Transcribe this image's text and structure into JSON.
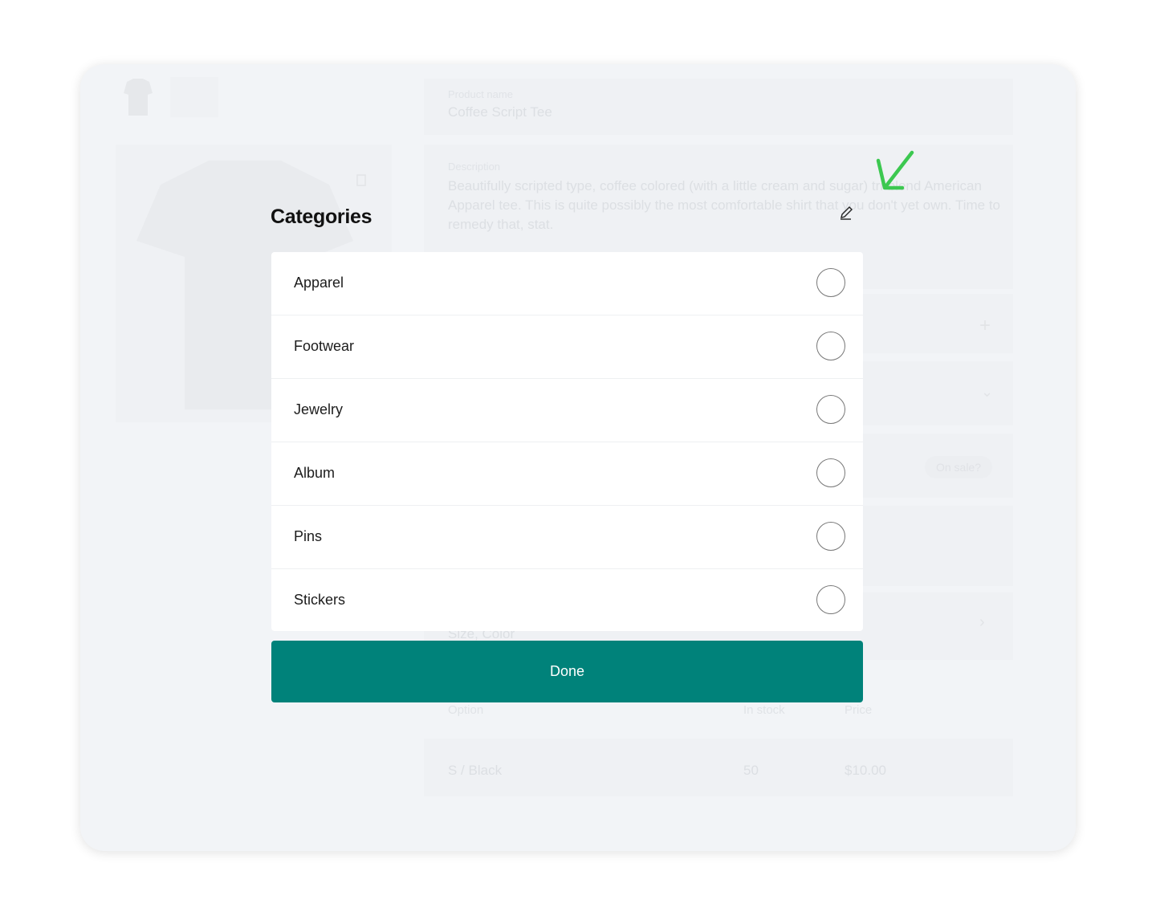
{
  "background": {
    "product_name_label": "Product name",
    "product_name_value": "Coffee Script Tee",
    "description_label": "Description",
    "description_value": "Beautifully scripted type, coffee colored (with a little cream and sugar) tri-blend American Apparel tee. This is quite possibly the most comfortable shirt that you don't yet own. Time to remedy that, stat.",
    "on_sale_label": "On sale?",
    "variants_value": "Size, Color",
    "table_headers": [
      "Option",
      "In stock",
      "Price"
    ],
    "table_rows": [
      [
        "S / Black",
        "50",
        "$10.00"
      ]
    ]
  },
  "modal": {
    "title": "Categories",
    "options": [
      {
        "label": "Apparel",
        "selected": false
      },
      {
        "label": "Footwear",
        "selected": false
      },
      {
        "label": "Jewelry",
        "selected": false
      },
      {
        "label": "Album",
        "selected": false
      },
      {
        "label": "Pins",
        "selected": false
      },
      {
        "label": "Stickers",
        "selected": false
      }
    ],
    "done_label": "Done"
  },
  "colors": {
    "accent": "#00827a",
    "annotation_arrow": "#3cc850"
  },
  "icons": [
    "tshirt-icon",
    "trash-icon",
    "plus-icon",
    "chevron-down-icon",
    "chevron-right-icon",
    "pencil-icon",
    "arrow-annotation-icon"
  ]
}
